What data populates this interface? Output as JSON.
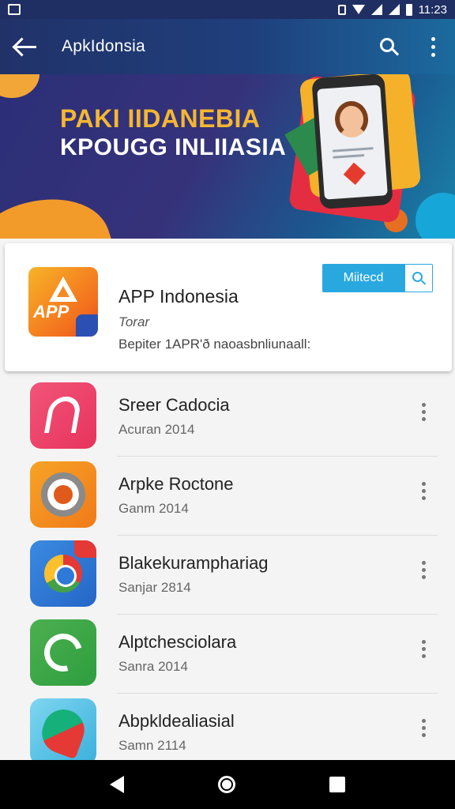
{
  "status_bar": {
    "time": "11:23"
  },
  "app_bar": {
    "title": "ApkIdonsia"
  },
  "banner": {
    "line1": "PAKI IIDANEBIA",
    "line2": "KPOUGG INLIIASIA"
  },
  "featured": {
    "name": "APP Indonesia",
    "subtitle": "Torar",
    "description": "Bepiter 1APR'ð naoasbnliunaall:",
    "install_label": "Miitecd",
    "icon_text": "APP"
  },
  "apps": [
    {
      "name": "Sreer Cadocia",
      "date": "Acuran 2014",
      "icon": "pink-a-icon"
    },
    {
      "name": "Arpke Roctone",
      "date": "Ganm 2014",
      "icon": "orange-ring-icon"
    },
    {
      "name": "Blakekuramphariag",
      "date": "Sanjar 2814",
      "icon": "chrome-icon"
    },
    {
      "name": "Alptchesciolara",
      "date": "Sanra 2014",
      "icon": "green-loop-icon"
    },
    {
      "name": "Abpkldealiasial",
      "date": "Samn 2114",
      "icon": "shield-icon"
    }
  ],
  "colors": {
    "app_bar": "#213269",
    "install_button": "#29a8e0",
    "banner_yellow": "#f5b731"
  }
}
